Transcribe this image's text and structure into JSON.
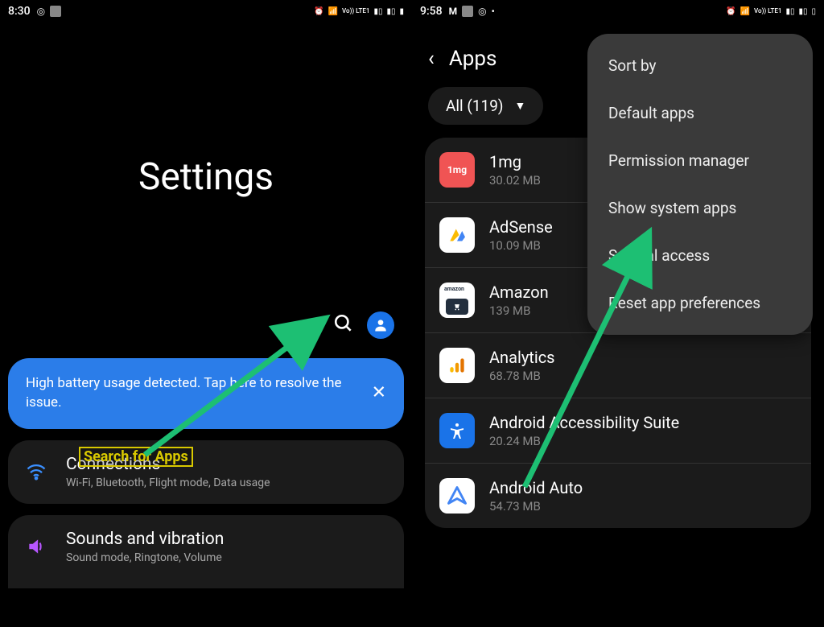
{
  "left": {
    "status": {
      "time": "8:30",
      "lte": "Vo)) LTE1"
    },
    "title": "Settings",
    "alert": "High battery usage detected. Tap here to resolve the issue.",
    "cards": [
      {
        "title": "Connections",
        "sub": "Wi-Fi, Bluetooth, Flight mode, Data usage"
      },
      {
        "title": "Sounds and vibration",
        "sub": "Sound mode, Ringtone, Volume"
      }
    ],
    "annotation": "Search for Apps"
  },
  "right": {
    "status": {
      "time": "9:58",
      "lte": "Vo)) LTE1"
    },
    "header": "Apps",
    "filter": "All (119)",
    "apps": [
      {
        "name": "1mg",
        "size": "30.02 MB",
        "bg": "#f05454",
        "label": "1mg"
      },
      {
        "name": "AdSense",
        "size": "10.09 MB",
        "bg": "#ffffff",
        "label": ""
      },
      {
        "name": "Amazon",
        "size": "139 MB",
        "bg": "#ffffff",
        "label": ""
      },
      {
        "name": "Analytics",
        "size": "68.78 MB",
        "bg": "#ffffff",
        "label": ""
      },
      {
        "name": "Android Accessibility Suite",
        "size": "20.24 MB",
        "bg": "#1a73e8",
        "label": ""
      },
      {
        "name": "Android Auto",
        "size": "54.73 MB",
        "bg": "#ffffff",
        "label": ""
      }
    ],
    "menu": [
      "Sort by",
      "Default apps",
      "Permission manager",
      "Show system apps",
      "Special access",
      "Reset app preferences"
    ]
  }
}
